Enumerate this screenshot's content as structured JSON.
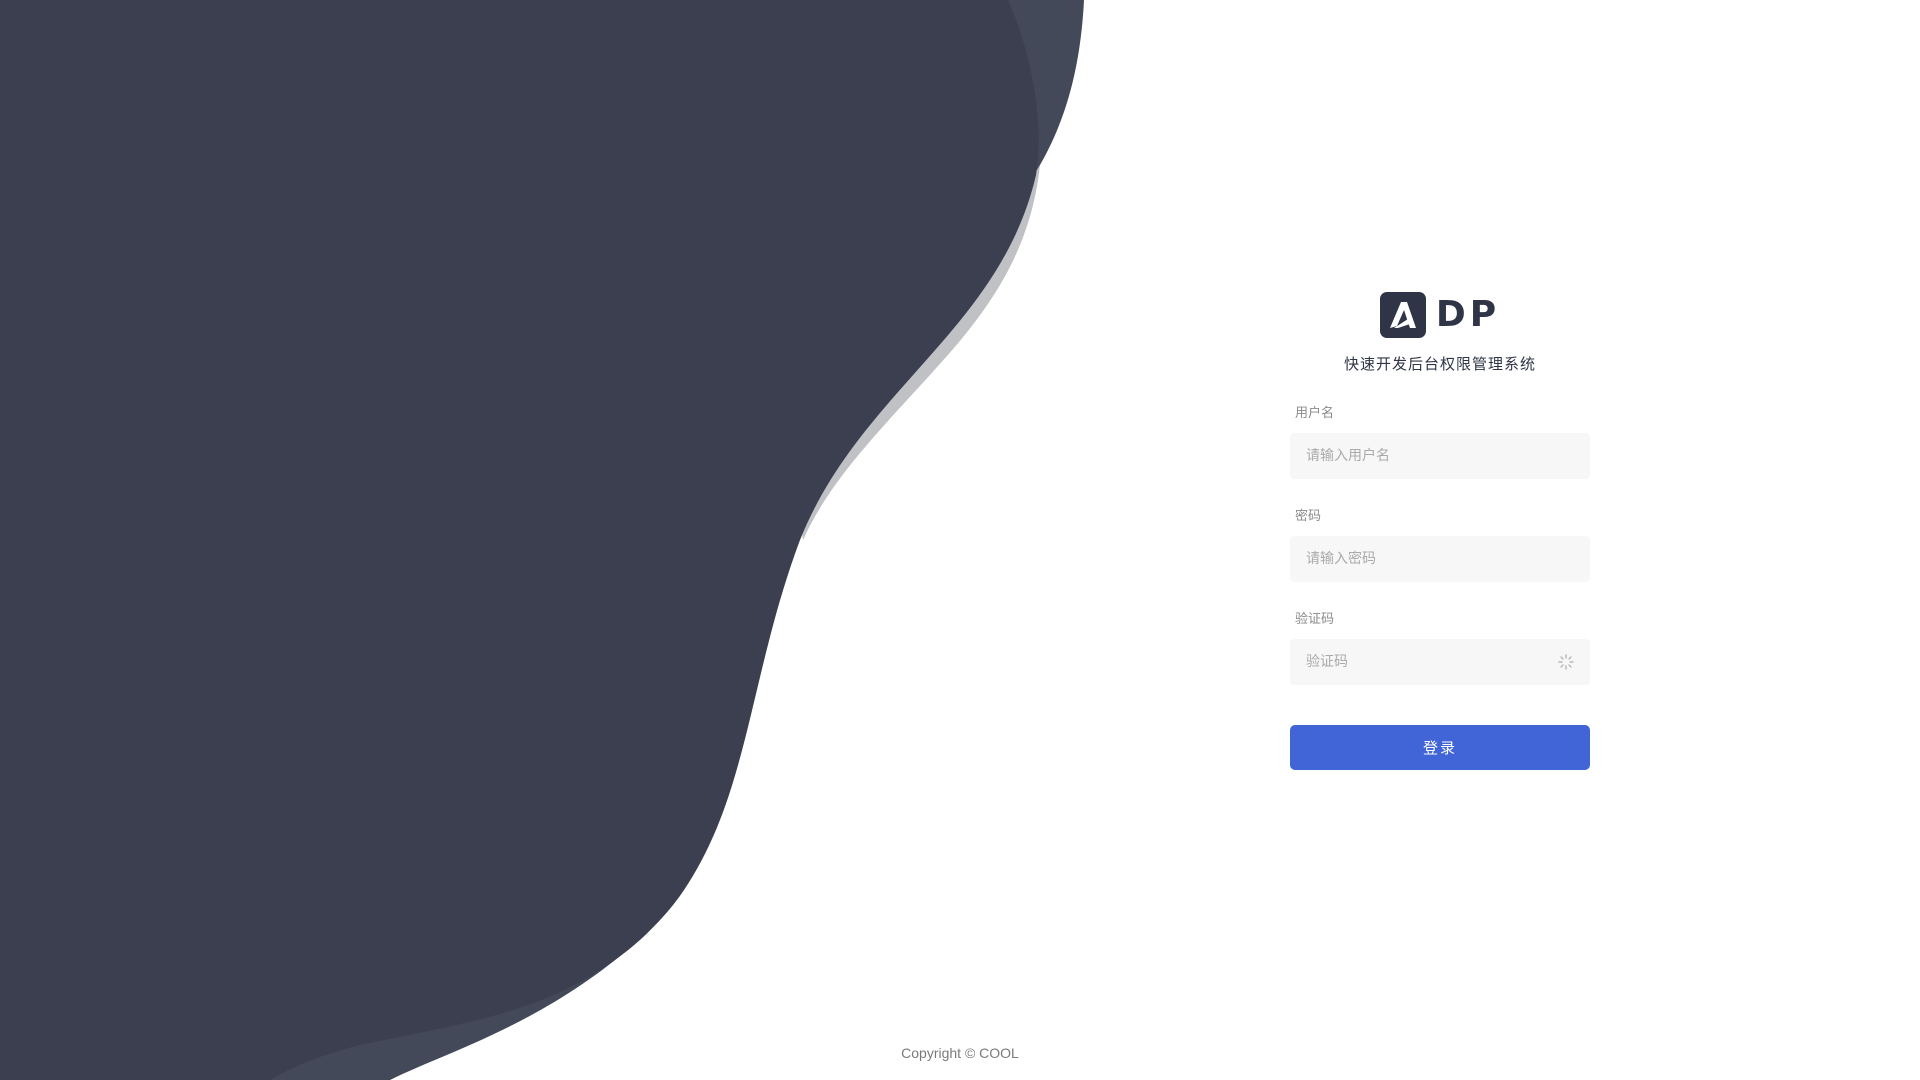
{
  "brand": {
    "logo_icon": "letter-a-logo-icon",
    "name": "DP",
    "subtitle": "快速开发后台权限管理系统"
  },
  "form": {
    "username": {
      "label": "用户名",
      "placeholder": "请输入用户名",
      "value": ""
    },
    "password": {
      "label": "密码",
      "placeholder": "请输入密码",
      "value": ""
    },
    "captcha": {
      "label": "验证码",
      "placeholder": "验证码",
      "value": "",
      "icon": "loading-spinner-icon"
    },
    "submit_label": "登录"
  },
  "footer": {
    "copyright": "Copyright © COOL"
  },
  "colors": {
    "dark_shape": "#3b3f4f",
    "mid_shape": "#434958",
    "light_shape": "#c0c1c5",
    "brand_dark": "#2f3447",
    "primary": "#4165d7",
    "input_bg": "#f7f7f7"
  }
}
